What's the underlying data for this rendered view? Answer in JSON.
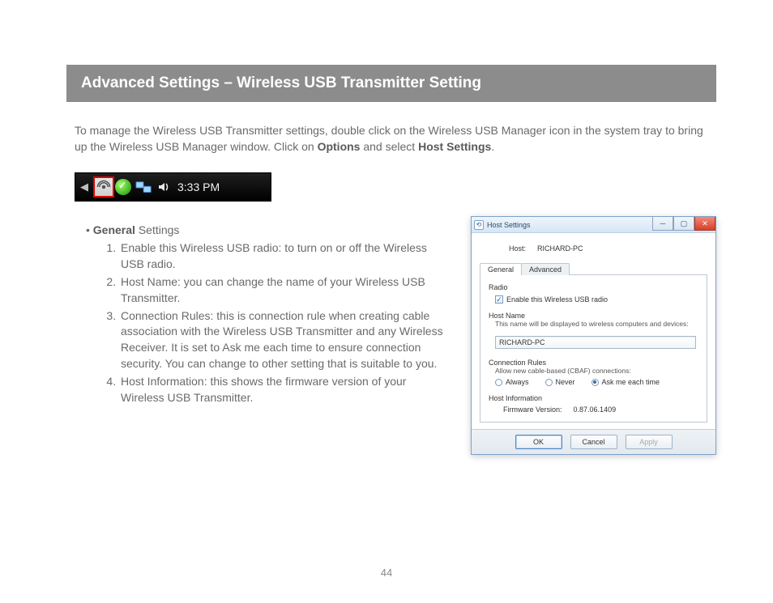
{
  "header": {
    "title": "Advanced Settings – Wireless USB Transmitter Setting"
  },
  "intro": {
    "pre": "To manage the Wireless USB Transmitter settings, double click on the Wireless USB Manager icon in the system tray to bring up the Wireless USB Manager window.  Click on ",
    "b1": "Options",
    "mid": " and select ",
    "b2": "Host Settings",
    "post": "."
  },
  "systray": {
    "time": "3:33 PM"
  },
  "general": {
    "label_bold": "General",
    "label_rest": " Settings",
    "items": [
      "Enable this Wireless USB radio: to turn on or off the Wireless USB radio.",
      "Host Name: you can change the name of your Wireless USB Transmitter.",
      "Connection Rules: this is connection rule when creating cable association with the Wireless USB Transmitter and any Wireless Receiver.  It is set to Ask me each time to ensure connection security.  You can change to other setting that is suitable to you.",
      "Host Information: this shows the firmware version of your Wireless USB Transmitter."
    ]
  },
  "dialog": {
    "title": "Host Settings",
    "host_label": "Host:",
    "host_value": "RICHARD-PC",
    "tab_general": "General",
    "tab_advanced": "Advanced",
    "grp_radio": "Radio",
    "cbx_label": "Enable this Wireless USB radio",
    "grp_hostname": "Host Name",
    "hostname_desc": "This name will be displayed to wireless computers and devices:",
    "hostname_value": "RICHARD-PC",
    "grp_rules": "Connection Rules",
    "rules_desc": "Allow new cable-based (CBAF) connections:",
    "opt_always": "Always",
    "opt_never": "Never",
    "opt_ask": "Ask me each time",
    "grp_hostinfo": "Host Information",
    "fw_label": "Firmware Version:",
    "fw_value": "0.87.06.1409",
    "btn_ok": "OK",
    "btn_cancel": "Cancel",
    "btn_apply": "Apply"
  },
  "page_number": "44"
}
